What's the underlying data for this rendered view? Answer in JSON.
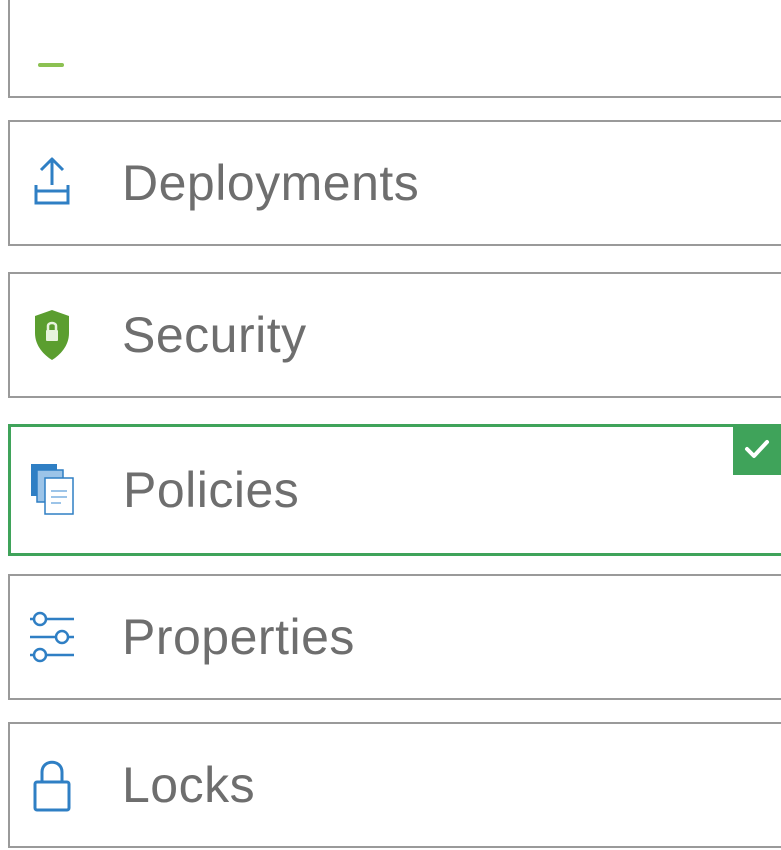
{
  "menu": {
    "items": [
      {
        "label": "",
        "icon": "partial-green-icon",
        "selected": false
      },
      {
        "label": "Deployments",
        "icon": "upload-icon",
        "selected": false
      },
      {
        "label": "Security",
        "icon": "shield-icon",
        "selected": false
      },
      {
        "label": "Policies",
        "icon": "policy-documents-icon",
        "selected": true
      },
      {
        "label": "Properties",
        "icon": "sliders-icon",
        "selected": false
      },
      {
        "label": "Locks",
        "icon": "lock-icon",
        "selected": false
      }
    ],
    "selected_badge_icon": "checkmark-icon"
  },
  "colors": {
    "selected_border": "#3fa35a",
    "item_border": "#9a9a9a",
    "label_text": "#6e6e6e",
    "icon_blue": "#2f7fc4",
    "shield_green": "#5b9e2f"
  }
}
